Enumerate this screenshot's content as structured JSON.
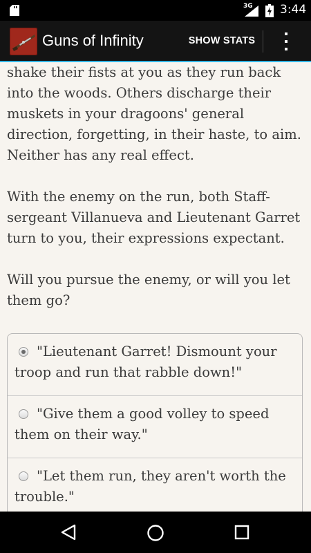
{
  "status_bar": {
    "network_type": "3G",
    "time": "3:44",
    "icons": [
      "sd-card-icon",
      "signal-icon",
      "battery-charging-icon"
    ]
  },
  "action_bar": {
    "app_icon": "musket-icon",
    "title": "Guns of Infinity",
    "show_stats_label": "SHOW STATS",
    "overflow_icon": "overflow-menu-icon"
  },
  "story": {
    "paragraphs": [
      "shake their fists at you as they run back into the woods. Others discharge their muskets in your dragoons' general direction, forgetting, in their haste, to aim. Neither has any real effect.",
      "With the enemy on the run, both Staff-sergeant Villanueva and Lieutenant Garret turn to you, their expressions expectant.",
      "Will you pursue the enemy, or will you let them go?"
    ]
  },
  "choices": [
    {
      "label": "\"Lieutenant Garret! Dismount your troop and run that rabble down!\"",
      "selected": true
    },
    {
      "label": "\"Give them a good volley to speed them on their way.\"",
      "selected": false
    },
    {
      "label": "\"Let them run, they aren't worth the trouble.\"",
      "selected": false
    }
  ],
  "nav_bar": {
    "icons": [
      "back-icon",
      "home-icon",
      "recent-apps-icon"
    ]
  },
  "colors": {
    "accent": "#33b5e5",
    "action_bar": "#141414",
    "background": "#f7f4ef",
    "text": "#3a3a3a"
  }
}
